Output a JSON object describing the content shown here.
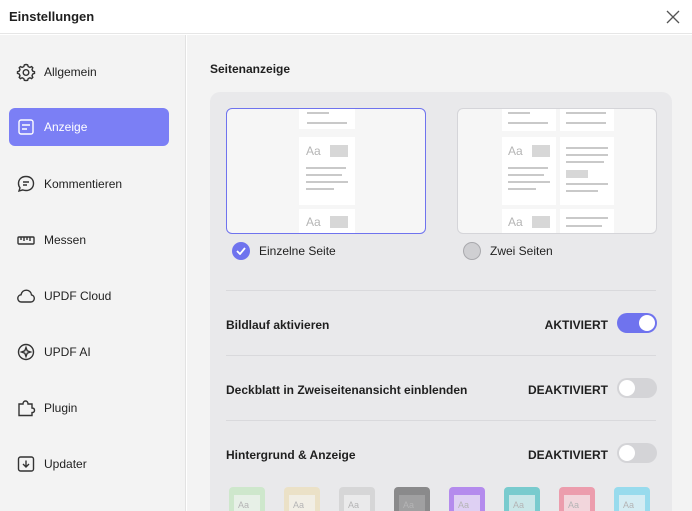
{
  "window": {
    "title": "Einstellungen"
  },
  "sidebar": {
    "items": [
      {
        "label": "Allgemein",
        "icon": "gear-icon"
      },
      {
        "label": "Anzeige",
        "icon": "display-icon",
        "active": true
      },
      {
        "label": "Kommentieren",
        "icon": "comment-icon"
      },
      {
        "label": "Messen",
        "icon": "ruler-icon"
      },
      {
        "label": "UPDF Cloud",
        "icon": "cloud-icon"
      },
      {
        "label": "UPDF AI",
        "icon": "ai-icon"
      },
      {
        "label": "Plugin",
        "icon": "puzzle-icon"
      },
      {
        "label": "Updater",
        "icon": "update-icon"
      }
    ]
  },
  "main": {
    "section_title": "Seitenanzeige",
    "page_layout": {
      "single": {
        "label": "Einzelne Seite",
        "selected": true,
        "glyph": "Aa"
      },
      "double": {
        "label": "Zwei Seiten",
        "selected": false,
        "glyph": "Aa"
      }
    },
    "settings": [
      {
        "label": "Bildlauf aktivieren",
        "state": "AKTIVIERT",
        "on": true
      },
      {
        "label": "Deckblatt in Zweiseitenansicht einblenden",
        "state": "DEAKTIVIERT",
        "on": false
      },
      {
        "label": "Hintergrund & Anzeige",
        "state": "DEAKTIVIERT",
        "on": false
      }
    ],
    "themes": [
      {
        "color": "#b9e6b3",
        "glyph": "Aa"
      },
      {
        "color": "#eedcaa",
        "glyph": "Aa"
      },
      {
        "color": "#c8c8c8",
        "glyph": "Aa"
      },
      {
        "color": "#3e3e3e",
        "glyph": "Aa"
      },
      {
        "color": "#8a3ff0",
        "glyph": "Aa"
      },
      {
        "color": "#1fb4b8",
        "glyph": "Aa"
      },
      {
        "color": "#f0607c",
        "glyph": "Aa"
      },
      {
        "color": "#56d0f0",
        "glyph": "Aa"
      }
    ]
  },
  "colors": {
    "accent": "#6f73ee",
    "sidebar_active": "#7b7ff5"
  }
}
